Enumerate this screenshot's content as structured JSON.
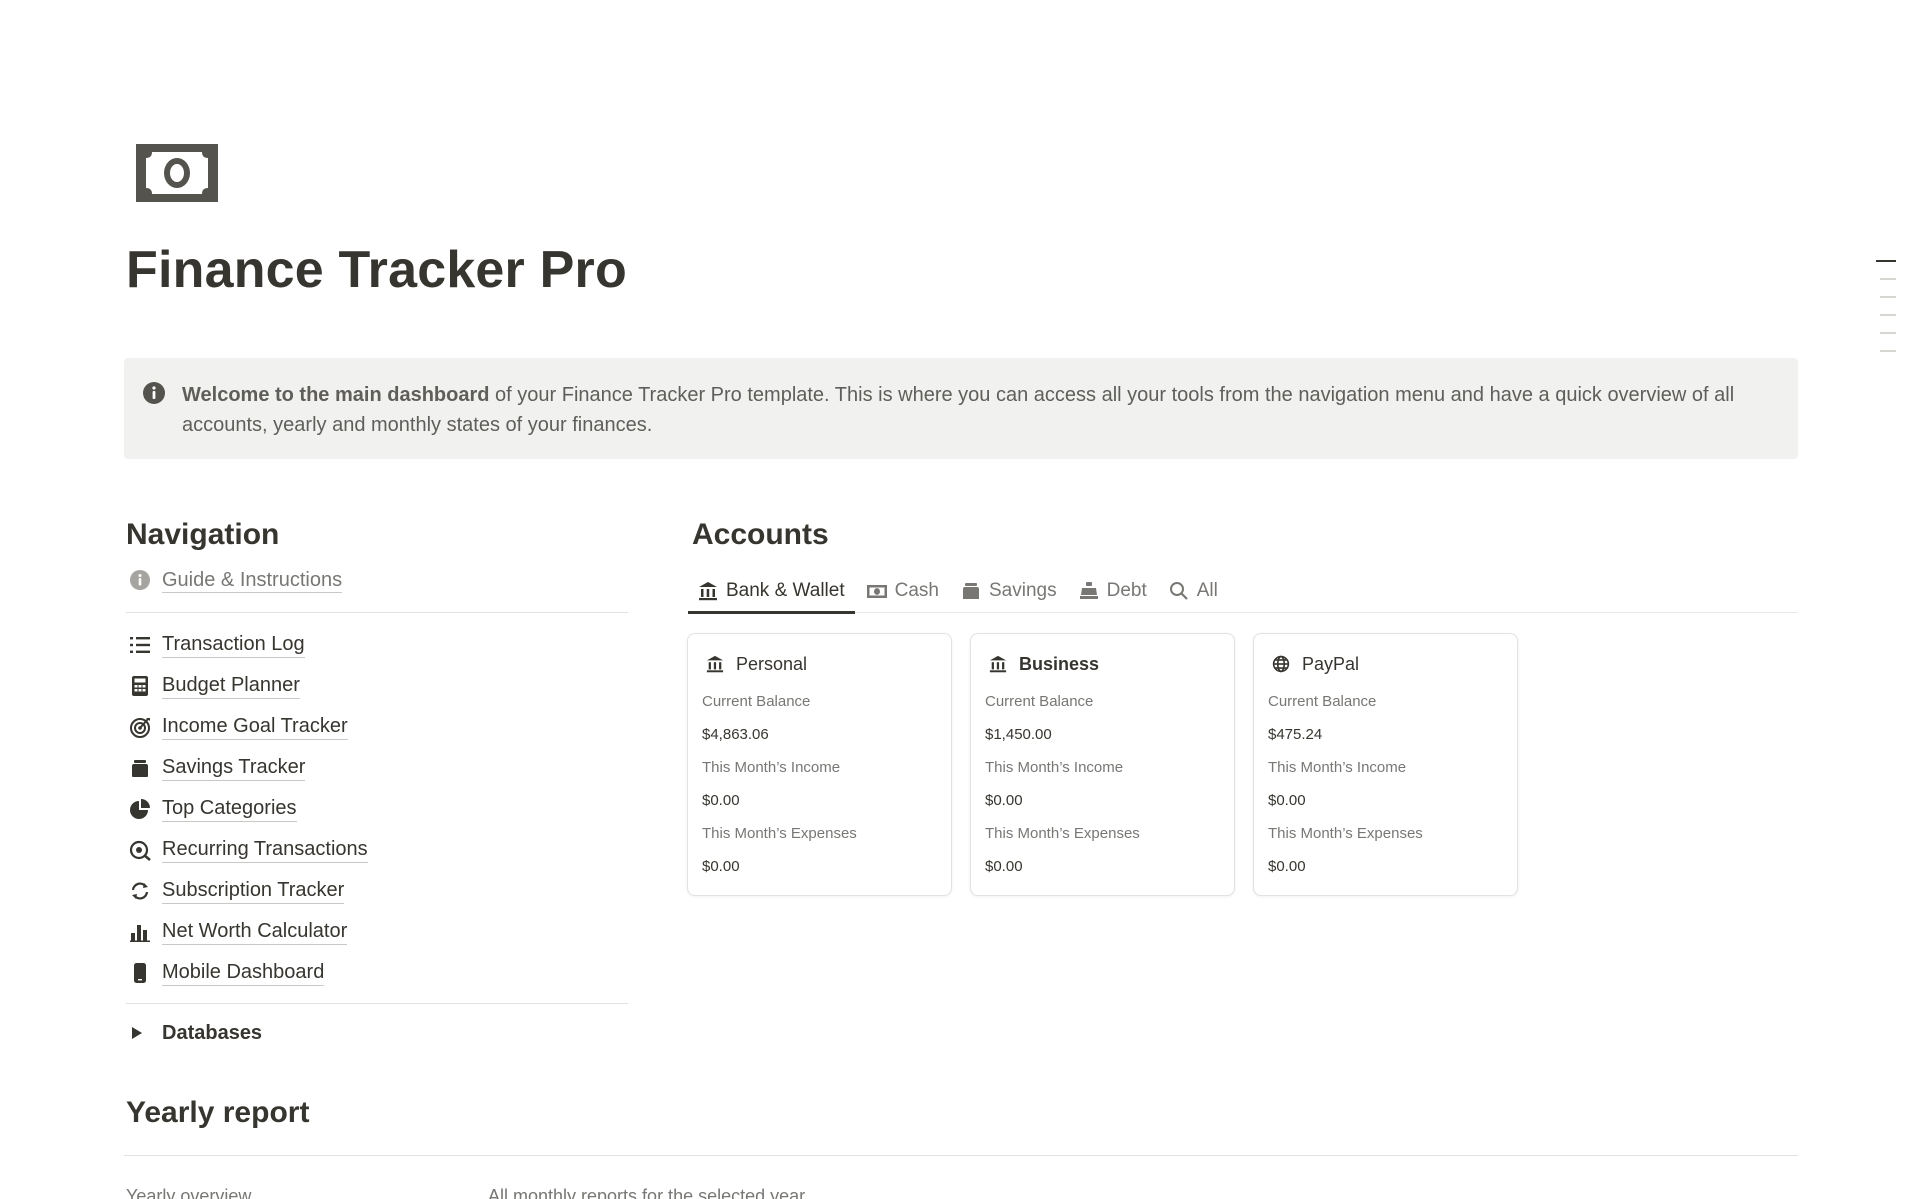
{
  "page": {
    "icon": "banknote-icon",
    "title": "Finance Tracker Pro"
  },
  "callout": {
    "icon": "info-icon",
    "bold_text": "Welcome to the main dashboard",
    "text": " of your Finance Tracker Pro template. This is where you can access all your tools from the navigation menu and have a quick overview of all accounts, yearly and monthly states of your finances."
  },
  "navigation": {
    "heading": "Navigation",
    "guide": {
      "label": "Guide & Instructions",
      "icon": "info-icon"
    },
    "items": [
      {
        "label": "Transaction Log",
        "icon": "list-icon"
      },
      {
        "label": "Budget Planner",
        "icon": "calculator-icon"
      },
      {
        "label": "Income Goal Tracker",
        "icon": "target-icon"
      },
      {
        "label": "Savings Tracker",
        "icon": "piggy-bank-icon"
      },
      {
        "label": "Top Categories",
        "icon": "pie-chart-icon"
      },
      {
        "label": "Recurring Transactions",
        "icon": "recurring-icon"
      },
      {
        "label": "Subscription Tracker",
        "icon": "refresh-icon"
      },
      {
        "label": "Net Worth Calculator",
        "icon": "bar-chart-icon"
      },
      {
        "label": "Mobile Dashboard",
        "icon": "phone-icon"
      }
    ],
    "databases_label": "Databases"
  },
  "accounts": {
    "heading": "Accounts",
    "tabs": [
      {
        "label": "Bank & Wallet",
        "icon": "bank-icon",
        "active": true
      },
      {
        "label": "Cash",
        "icon": "banknote-icon",
        "active": false
      },
      {
        "label": "Savings",
        "icon": "piggy-bank-icon",
        "active": false
      },
      {
        "label": "Debt",
        "icon": "debt-icon",
        "active": false
      },
      {
        "label": "All",
        "icon": "search-icon",
        "active": false
      }
    ],
    "field_labels": {
      "balance": "Current Balance",
      "income": "This Month’s Income",
      "expenses": "This Month’s Expenses"
    },
    "cards": [
      {
        "name": "Personal",
        "icon": "bank-icon",
        "balance": "$4,863.06",
        "income": "$0.00",
        "expenses": "$0.00"
      },
      {
        "name": "Business",
        "icon": "bank-icon",
        "balance": "$1,450.00",
        "income": "$0.00",
        "expenses": "$0.00"
      },
      {
        "name": "PayPal",
        "icon": "globe-icon",
        "balance": "$475.24",
        "income": "$0.00",
        "expenses": "$0.00"
      }
    ]
  },
  "yearly": {
    "heading": "Yearly report",
    "overview_label": "Yearly overview",
    "monthly_label": "All monthly reports for the selected year"
  },
  "colors": {
    "text": "#37352f",
    "muted": "#787774",
    "callout_bg": "#f1f1ef",
    "border": "#e3e2e0"
  }
}
